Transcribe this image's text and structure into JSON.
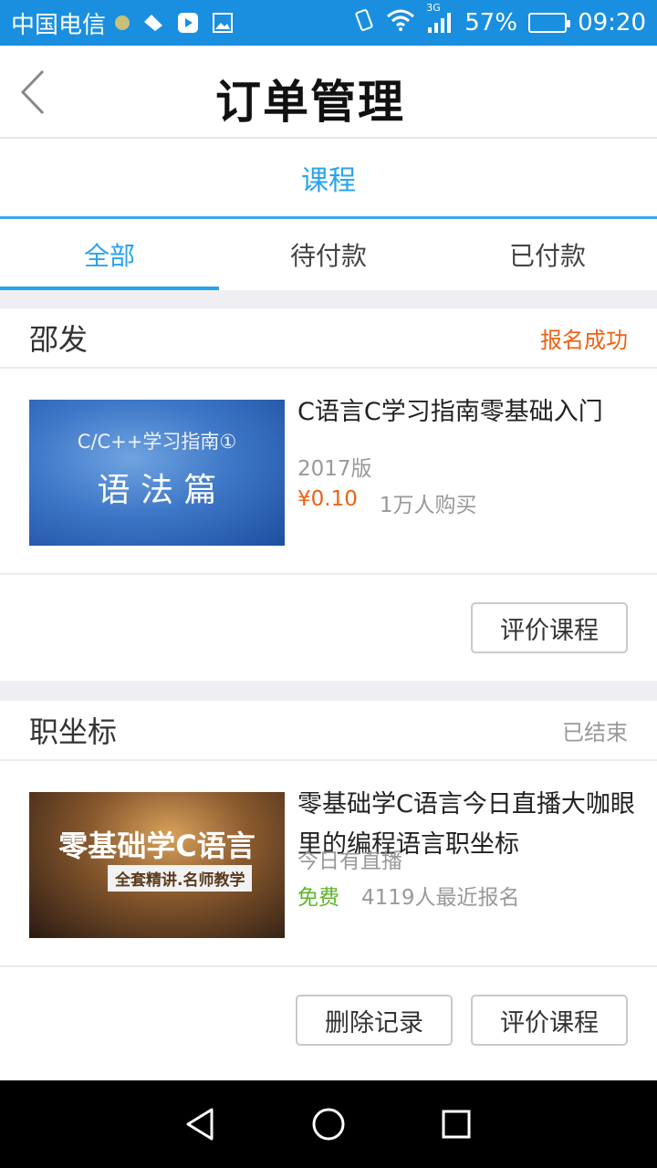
{
  "status_bar": {
    "carrier": "中国电信",
    "network": "3G",
    "battery": "57%",
    "battery_level": 0.57,
    "time": "09:20"
  },
  "header": {
    "title": "订单管理",
    "back_icon": "chevron-left-icon"
  },
  "category": {
    "label": "课程"
  },
  "filter_tabs": [
    {
      "label": "全部",
      "active": true
    },
    {
      "label": "待付款",
      "active": false
    },
    {
      "label": "已付款",
      "active": false
    }
  ],
  "orders": [
    {
      "teacher": "邵发",
      "status": "报名成功",
      "status_color": "#f06012",
      "thumbnail": {
        "line1": "C/C++学习指南①",
        "line2": "语 法 篇"
      },
      "course_title": "C语言C学习指南零基础入门",
      "meta": "2017版",
      "price": "¥0.10",
      "price_color": "#f06012",
      "buyers": "1万人购买",
      "buttons": [
        "评价课程"
      ]
    },
    {
      "teacher": "职坐标",
      "status": "已结束",
      "status_color": "#999999",
      "thumbnail": {
        "line1": "零基础学C语言",
        "line2": "全套精讲.名师教学"
      },
      "course_title": "零基础学C语言今日直播大咖眼里的编程语言职坐标",
      "meta": "今日有直播",
      "price": "免费",
      "price_color": "#5bb52a",
      "buyers": "4119人最近报名",
      "buttons": [
        "删除记录",
        "评价课程"
      ]
    }
  ],
  "nav_bar": {
    "back": "triangle-back-icon",
    "home": "circle-home-icon",
    "recent": "square-recent-icon"
  },
  "colors": {
    "accent": "#29a3ee",
    "status_bar": "#1a8fe0"
  }
}
